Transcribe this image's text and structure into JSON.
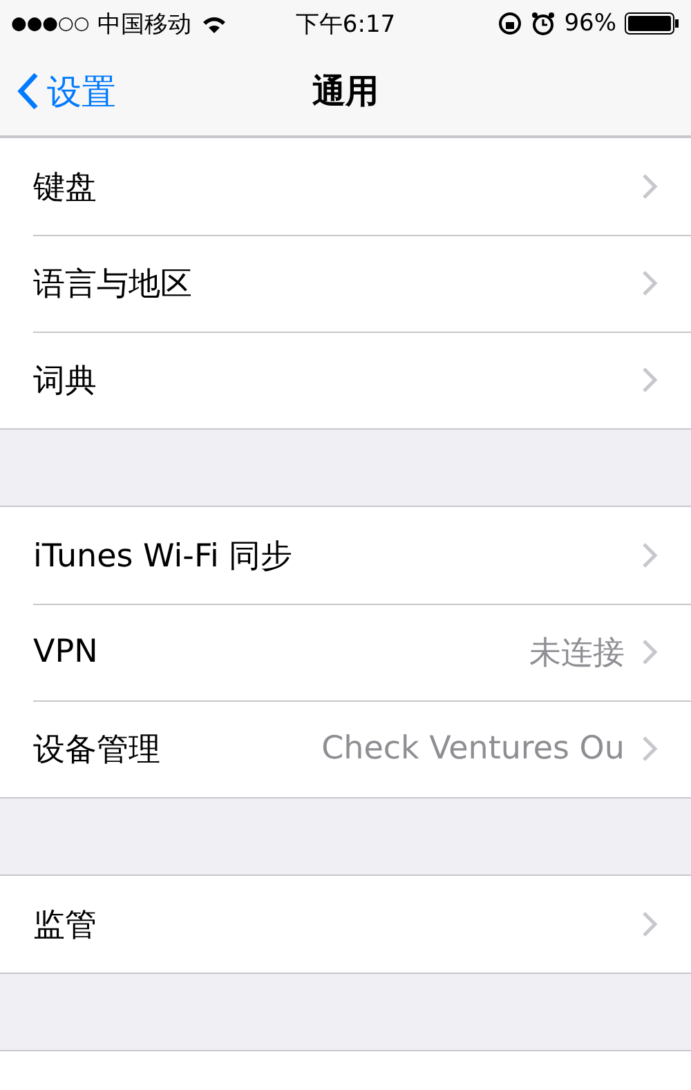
{
  "status_bar": {
    "signal": "●●●○○",
    "carrier": "中国移动",
    "time": "下午6:17",
    "battery": "96%"
  },
  "nav": {
    "back": "设置",
    "title": "通用"
  },
  "sections": [
    {
      "rows": [
        {
          "label": "键盘"
        },
        {
          "label": "语言与地区"
        },
        {
          "label": "词典"
        }
      ]
    },
    {
      "rows": [
        {
          "label": "iTunes Wi-Fi 同步"
        },
        {
          "label": "VPN",
          "value": "未连接"
        },
        {
          "label": "设备管理",
          "value": "Check Ventures Ou"
        }
      ]
    },
    {
      "rows": [
        {
          "label": "监管"
        }
      ]
    }
  ]
}
